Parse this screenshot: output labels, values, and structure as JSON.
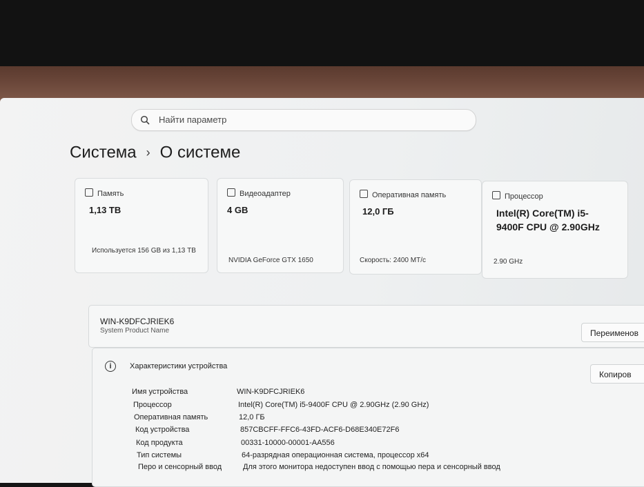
{
  "search": {
    "placeholder": "Найти параметр"
  },
  "breadcrumb": {
    "parent": "Система",
    "separator": "›",
    "current": "О системе"
  },
  "cards": [
    {
      "title": "Память",
      "value": "1,13 TB",
      "sub": "Используется 156 GB из 1,13 TB"
    },
    {
      "title": "Видеоадаптер",
      "value": "4 GB",
      "sub": "NVIDIA GeForce GTX 1650"
    },
    {
      "title": "Оперативная память",
      "value": "12,0 ГБ",
      "sub": "Скорость: 2400 МТ/с"
    },
    {
      "title": "Процессор",
      "value": "Intel(R) Core(TM) i5-9400F CPU @ 2.90GHz",
      "sub": "2.90 GHz"
    }
  ],
  "device": {
    "name": "WIN-K9DFCJRIEK6",
    "model": "System Product Name",
    "rename_label": "Переименов"
  },
  "specs": {
    "title": "Характеристики устройства",
    "info_icon": "i",
    "copy_label": "Копиров",
    "rows": [
      {
        "key": "Имя устройства",
        "value": "WIN-K9DFCJRIEK6"
      },
      {
        "key": "Процессор",
        "value": "Intel(R) Core(TM) i5-9400F CPU @ 2.90GHz (2.90 GHz)"
      },
      {
        "key": "Оперативная память",
        "value": "12,0 ГБ"
      },
      {
        "key": "Код устройства",
        "value": "857CBCFF-FFC6-43FD-ACF6-D68E340E72F6"
      },
      {
        "key": "Код продукта",
        "value": "00331-10000-00001-AA556"
      },
      {
        "key": "Тип системы",
        "value": "64-разрядная операционная система, процессор x64"
      },
      {
        "key": "Перо и сенсорный ввод",
        "value": "Для этого монитора недоступен ввод с помощью пера и сенсорный ввод"
      }
    ]
  }
}
